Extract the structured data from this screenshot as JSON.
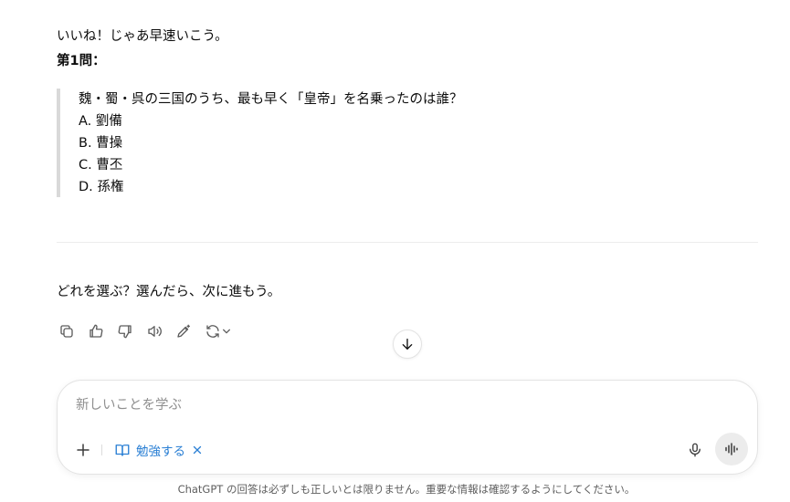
{
  "conversation": {
    "intro": "いいね！じゃあ早速いこう。",
    "question_heading": "第1問：",
    "quiz": {
      "question": "魏・蜀・呉の三国のうち、最も早く「皇帝」を名乗ったのは誰？",
      "options": [
        "A. 劉備",
        "B. 曹操",
        "C. 曹丕",
        "D. 孫権"
      ]
    },
    "followup": "どれを選ぶ？選んだら、次に進もう。"
  },
  "message_actions": {
    "icons": [
      "copy-icon",
      "thumbs-up-icon",
      "thumbs-down-icon",
      "read-aloud-icon",
      "edit-icon",
      "regenerate-icon"
    ]
  },
  "composer": {
    "placeholder": "新しいことを学ぶ",
    "value": "",
    "study_chip_label": "勉強する",
    "accent_color": "#2a7fd4"
  },
  "footer": {
    "disclaimer": "ChatGPT の回答は必ずしも正しいとは限りません。重要な情報は確認するようにしてください。"
  }
}
